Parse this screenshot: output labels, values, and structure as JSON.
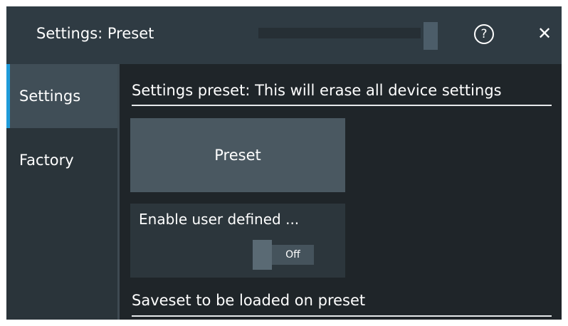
{
  "window": {
    "title": "Settings: Preset",
    "help_icon": "?",
    "close_icon": "✕"
  },
  "sidebar": {
    "items": [
      {
        "label": "Settings",
        "active": true
      },
      {
        "label": "Factory",
        "active": false
      }
    ]
  },
  "main": {
    "preset_section_label": "Settings preset: This will erase all device settings",
    "preset_button_label": "Preset",
    "user_defined_label": "Enable user defined ...",
    "user_defined_toggle_value": "Off",
    "saveset_section_label": "Saveset to be loaded on preset"
  },
  "colors": {
    "titlebar": "#2f3b43",
    "background": "#1f2529",
    "accent": "#1f9bd9",
    "button": "#4a5861"
  }
}
